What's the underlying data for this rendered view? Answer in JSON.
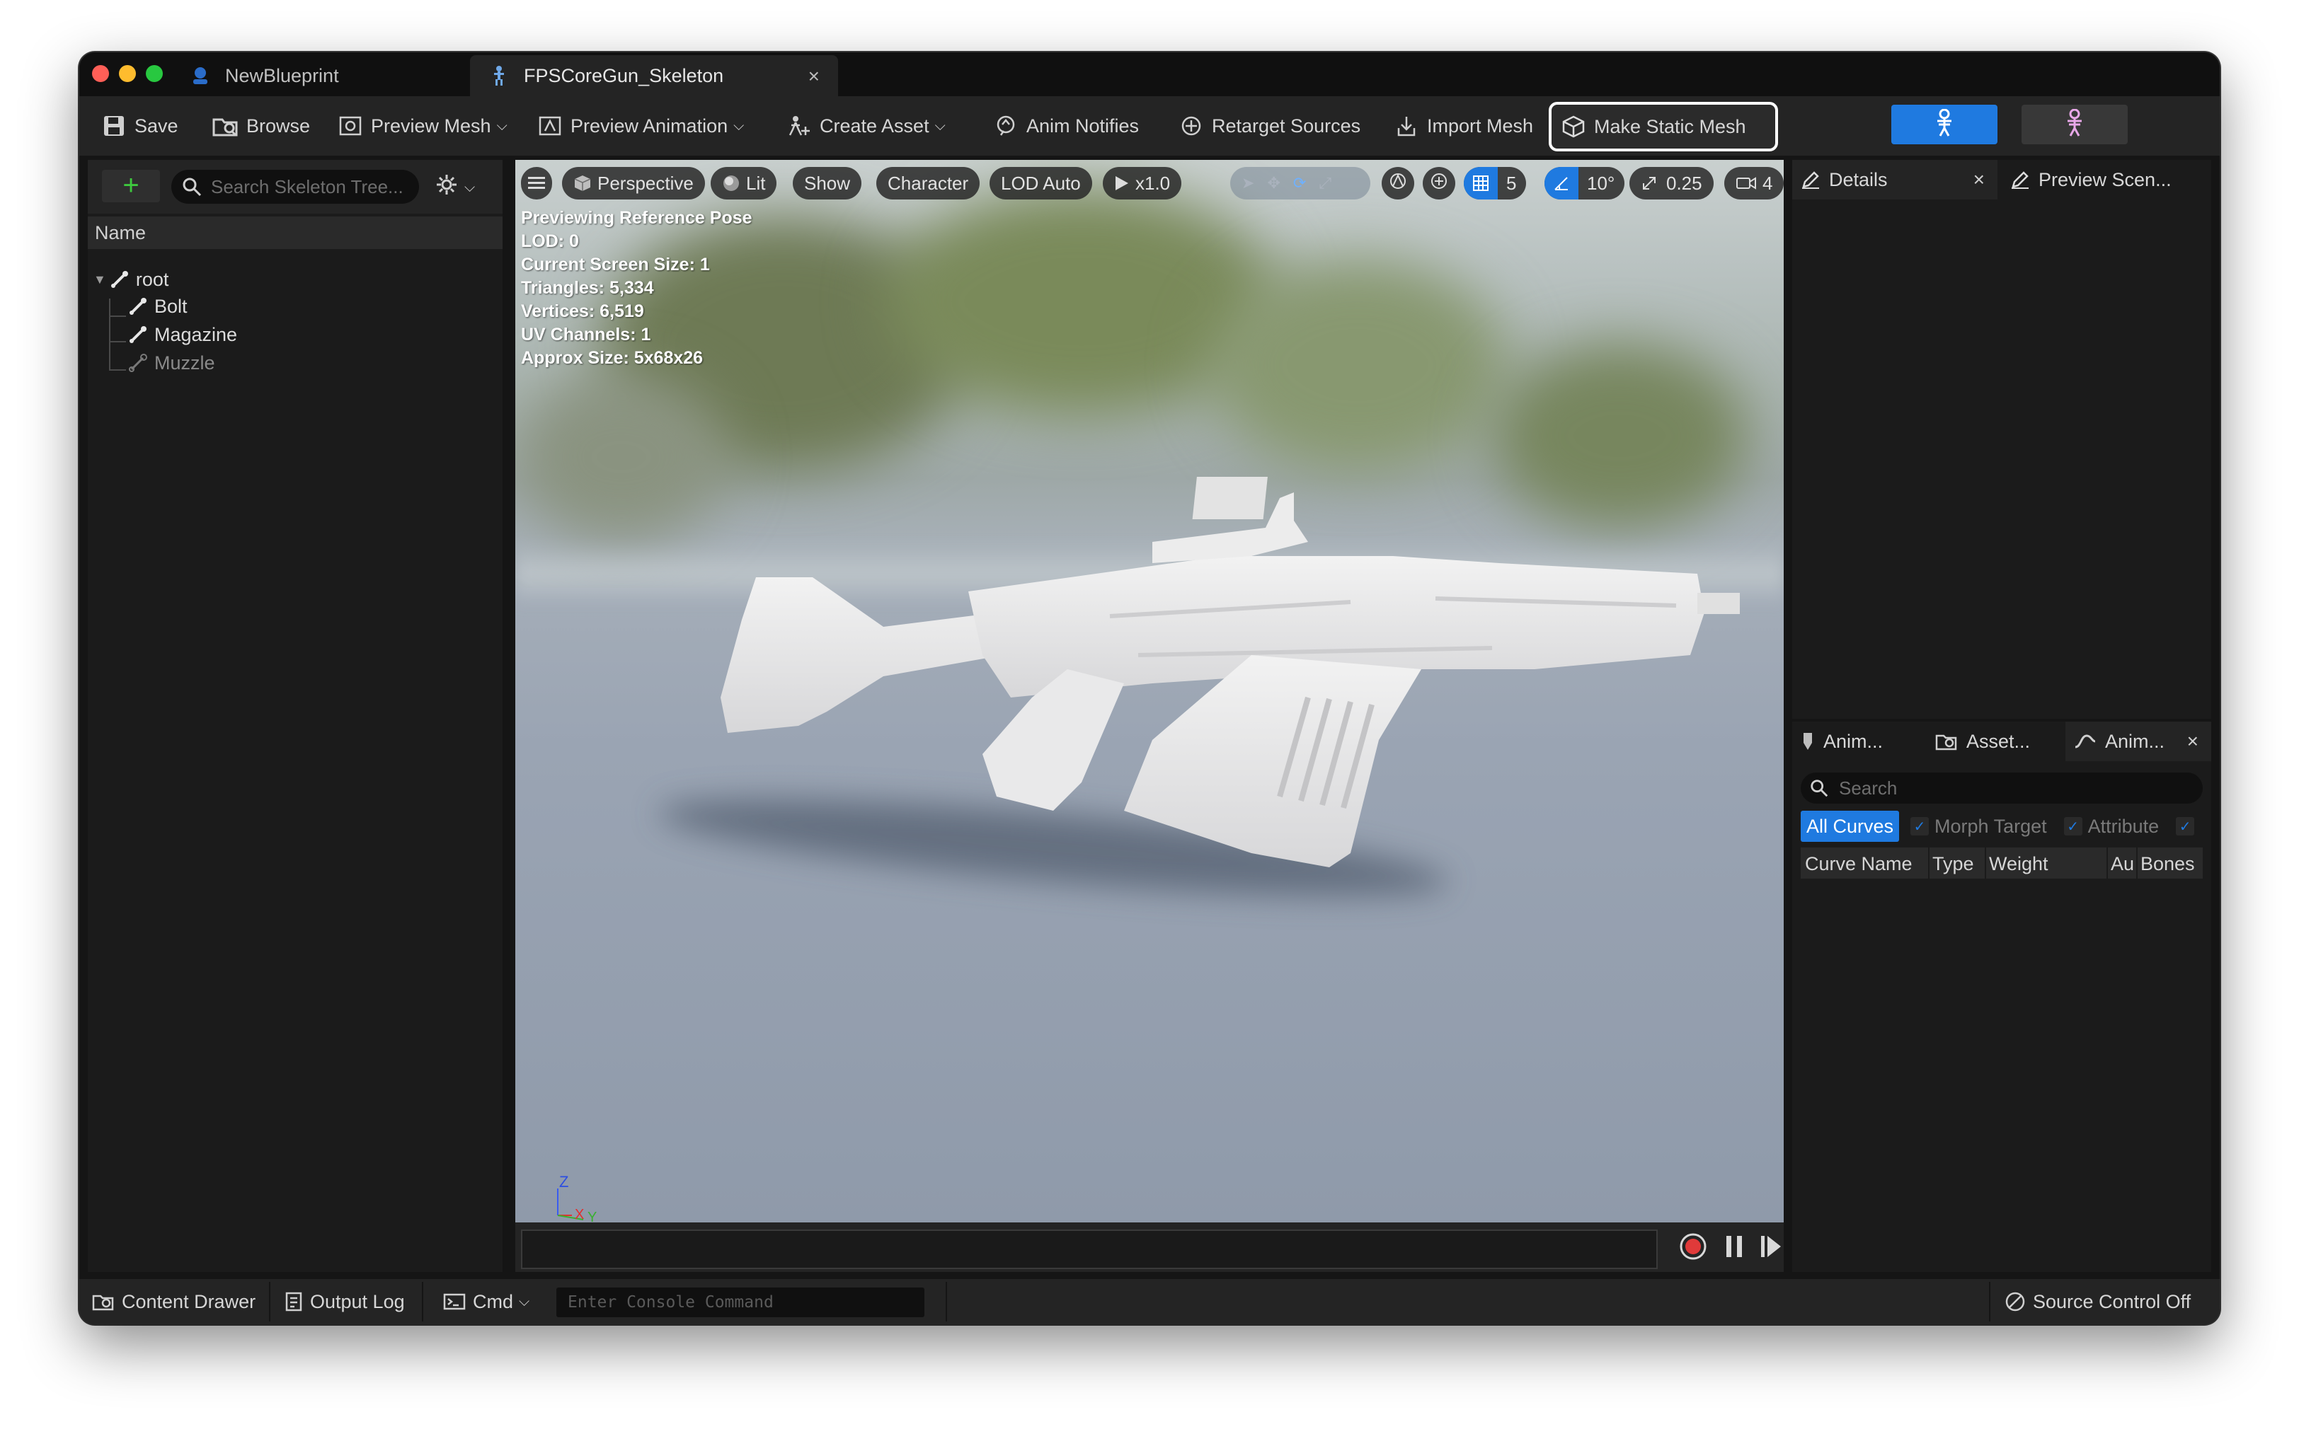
{
  "window": {
    "tabs": [
      {
        "label": "NewBlueprint"
      },
      {
        "label": "FPSCoreGun_Skeleton"
      }
    ]
  },
  "toolbar": {
    "save": "Save",
    "browse": "Browse",
    "preview_mesh": "Preview Mesh",
    "preview_animation": "Preview Animation",
    "create_asset": "Create Asset",
    "anim_notifies": "Anim Notifies",
    "retarget_sources": "Retarget Sources",
    "import_mesh": "Import Mesh",
    "make_static_mesh": "Make Static Mesh"
  },
  "skeleton_tree": {
    "search_placeholder": "Search Skeleton Tree...",
    "column_name": "Name",
    "bones": [
      "root",
      "Bolt",
      "Magazine",
      "Muzzle"
    ]
  },
  "viewport": {
    "perspective": "Perspective",
    "lit": "Lit",
    "show": "Show",
    "character": "Character",
    "lod": "LOD Auto",
    "play_rate": "x1.0",
    "grid_snap": "5",
    "rotation_snap": "10°",
    "scale_snap": "0.25",
    "camera_speed": "4",
    "stats": [
      "Previewing Reference Pose",
      "LOD: 0",
      "Current Screen Size: 1",
      "Triangles: 5,334",
      "Vertices: 6,519",
      "UV Channels: 1",
      "Approx Size: 5x68x26"
    ],
    "axis": {
      "z": "Z",
      "x": "X",
      "y": "Y"
    }
  },
  "details_panel": {
    "tab_details": "Details",
    "tab_preview_scene": "Preview Scen..."
  },
  "curves_panel": {
    "tabs": [
      "Anim...",
      "Asset...",
      "Anim..."
    ],
    "search_placeholder": "Search",
    "filters": {
      "all": "All Curves",
      "morph": "Morph Target",
      "attribute": "Attribute"
    },
    "columns": [
      "Curve Name",
      "Type",
      "Weight",
      "Au",
      "Bones"
    ]
  },
  "statusbar": {
    "content_drawer": "Content Drawer",
    "output_log": "Output Log",
    "cmd": "Cmd",
    "console_placeholder": "Enter Console Command",
    "source_control": "Source Control Off"
  },
  "colors": {
    "accent_blue": "#1f7ae0",
    "panel_bg": "#1b1b1b",
    "toolbar_bg": "#242424",
    "add_green": "#3ec93e",
    "record_red": "#e03a3a"
  }
}
